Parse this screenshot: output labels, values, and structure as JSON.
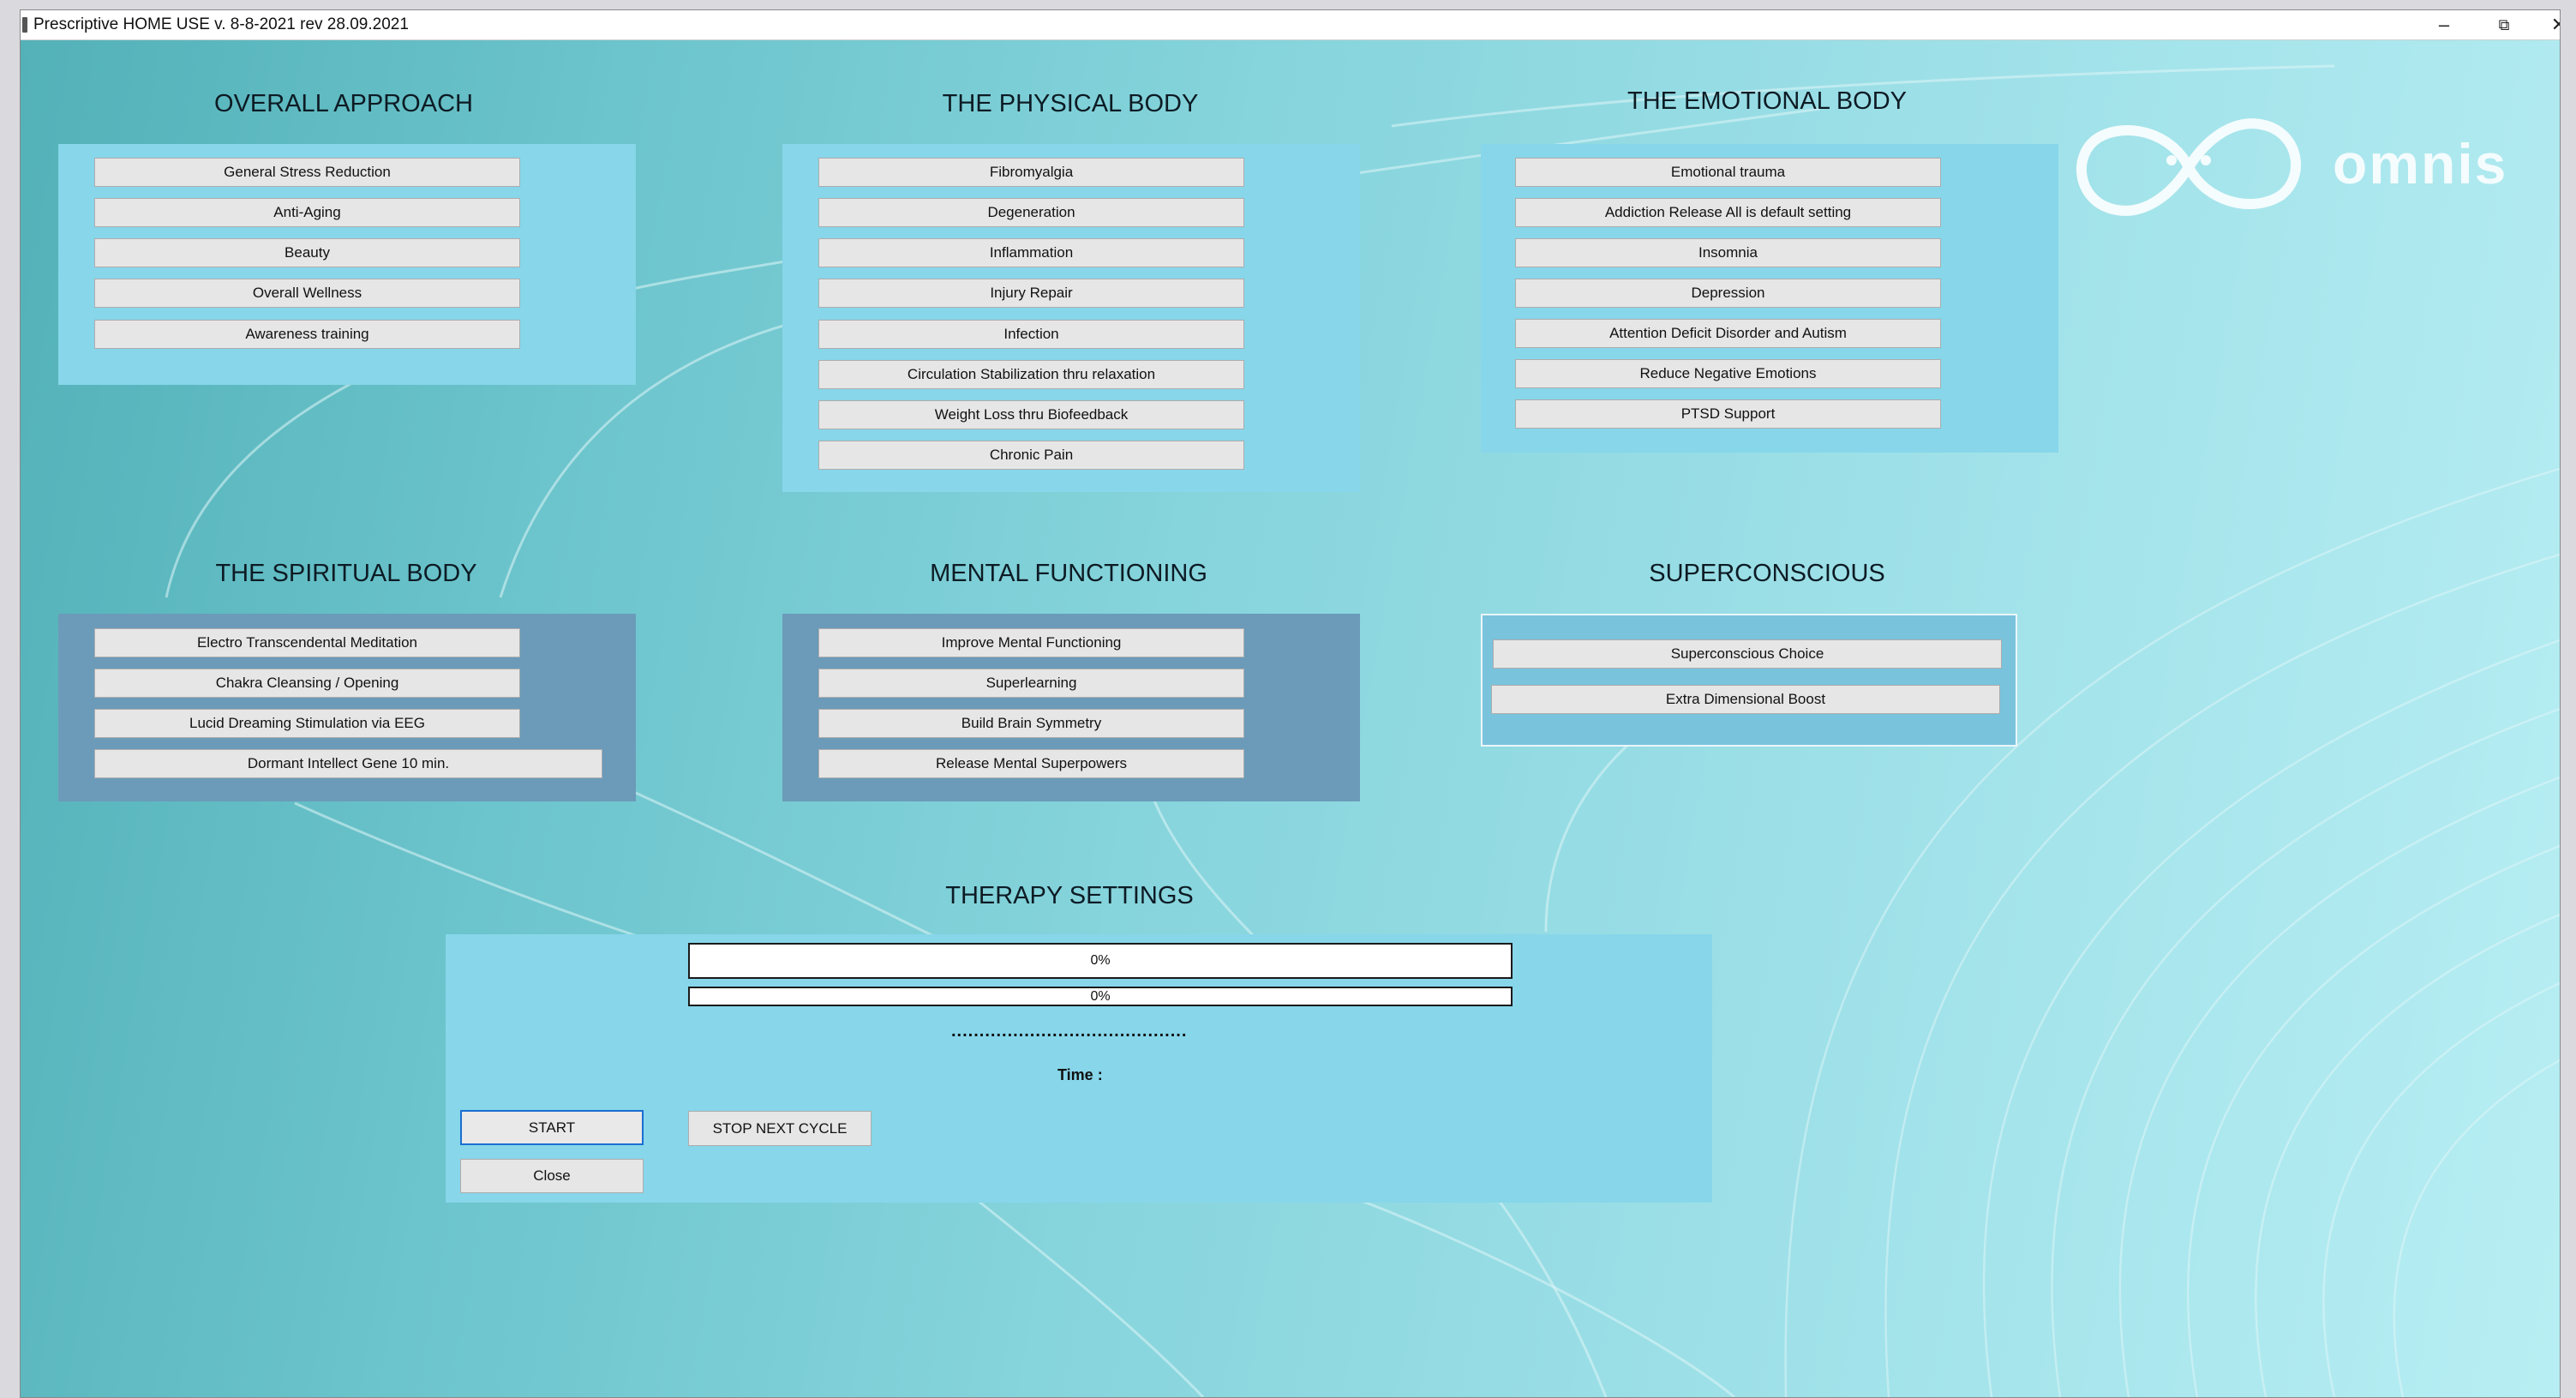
{
  "window": {
    "title": "Prescriptive HOME USE v. 8-8-2021 rev 28.09.2021",
    "controls": {
      "minimize": "–",
      "maximize": "⧉",
      "close": "✕"
    }
  },
  "brand": {
    "name": "omnis",
    "logo_icon": "infinity-logo-icon"
  },
  "sections": {
    "overall": {
      "title": "OVERALL APPROACH",
      "items": [
        "General Stress Reduction",
        "Anti-Aging",
        "Beauty",
        "Overall Wellness",
        "Awareness training"
      ]
    },
    "physical": {
      "title": "THE PHYSICAL BODY",
      "items": [
        "Fibromyalgia",
        "Degeneration",
        "Inflammation",
        "Injury Repair",
        "Infection",
        "Circulation Stabilization thru relaxation",
        "Weight Loss thru Biofeedback",
        "Chronic Pain"
      ]
    },
    "emotional": {
      "title": "THE EMOTIONAL BODY",
      "items": [
        "Emotional trauma",
        "Addiction  Release All is default setting",
        "Insomnia",
        "Depression",
        "Attention Deficit Disorder and Autism",
        "Reduce Negative Emotions",
        "PTSD Support"
      ]
    },
    "spiritual": {
      "title": "THE SPIRITUAL BODY",
      "items": [
        "Electro Transcendental Meditation",
        "Chakra Cleansing / Opening",
        "Lucid Dreaming Stimulation via EEG",
        "Dormant Intellect Gene 10 min."
      ]
    },
    "mental": {
      "title": "MENTAL FUNCTIONING",
      "items": [
        "Improve Mental Functioning",
        "Superlearning",
        "Build Brain Symmetry",
        "Release Mental Superpowers"
      ]
    },
    "superconscious": {
      "title": "SUPERCONSCIOUS",
      "items": [
        "Superconscious Choice",
        "Extra Dimensional Boost"
      ]
    }
  },
  "therapy": {
    "title": "THERAPY SETTINGS",
    "progress1": {
      "label": "0%",
      "value": 0
    },
    "progress2": {
      "label": "0%",
      "value": 0
    },
    "separator": "..........................................",
    "time_label": "Time :",
    "start_label": "START",
    "stop_label": "STOP NEXT CYCLE",
    "close_label": "Close"
  },
  "colors": {
    "panel_light": "#87d6ea",
    "panel_dark": "#6b9bb9",
    "button_face": "#e6e6e6",
    "start_focus": "#1a6fd1"
  }
}
